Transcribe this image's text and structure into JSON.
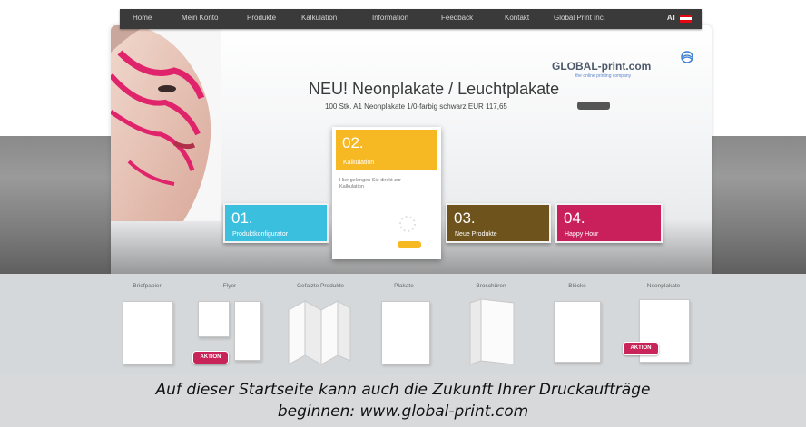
{
  "nav": {
    "items": [
      "Home",
      "Mein Konto",
      "Produkte",
      "Kalkulation",
      "Information",
      "Feedback",
      "Kontakt",
      "Global Print Inc."
    ],
    "language": "AT"
  },
  "brand": {
    "logo_text": "GLOBAL-print.com",
    "tagline": "the online printing company"
  },
  "hero": {
    "headline": "NEU! Neonplakate / Leuchtplakate",
    "subline": "100 Stk. A1 Neonplakate 1/0-farbig schwarz EUR 117,65"
  },
  "tiles": [
    {
      "number": "01.",
      "label": "Produktkonfigurator",
      "color": "#3bbfdf"
    },
    {
      "number": "02.",
      "label": "Kalkulation",
      "color": "#f6b823",
      "text": "Hier gelangen Sie direkt zur Kalkulation"
    },
    {
      "number": "03.",
      "label": "Neue Produkte",
      "color": "#6e531c"
    },
    {
      "number": "04.",
      "label": "Happy Hour",
      "color": "#c9205c"
    }
  ],
  "products": [
    {
      "label": "Briefpapier"
    },
    {
      "label": "Flyer",
      "badge": "AKTION"
    },
    {
      "label": "Gefalzte Produkte"
    },
    {
      "label": "Plakate"
    },
    {
      "label": "Broschüren"
    },
    {
      "label": "Blöcke"
    },
    {
      "label": "Neonplakate",
      "badge": "AKTION"
    }
  ],
  "caption": {
    "line1": "Auf dieser Startseite kann auch die Zukunft Ihrer Druckaufträge",
    "line2": "beginnen: www.global-print.com"
  },
  "colors": {
    "nav_bg": "#3a3a3a",
    "badge": "#c8245a",
    "accent_orange": "#f6b823"
  }
}
